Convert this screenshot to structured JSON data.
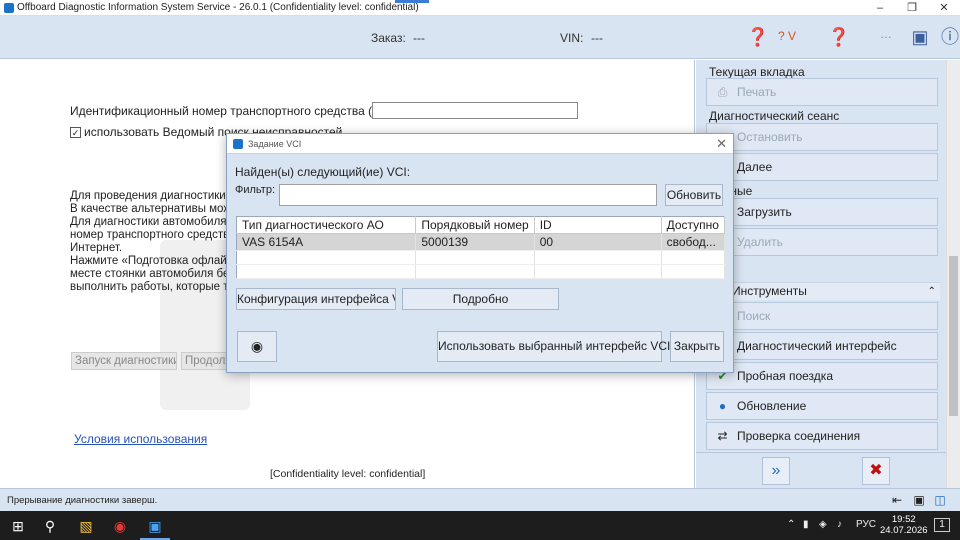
{
  "window": {
    "title": "Offboard Diagnostic Information System Service - 26.0.1 (Confidentiality level: confidential)",
    "controls": [
      "minimize-icon",
      "restore-icon",
      "close-icon"
    ]
  },
  "header": {
    "order_label": "Заказ:",
    "order_value": "---",
    "vin_label": "VIN:",
    "vin_value": "---",
    "help_version": "? V"
  },
  "main": {
    "vin_field_label": "Идентификационный номер транспортного средства (VIN)",
    "vin_field_value": "",
    "guided_search_label": "использовать Ведомый поиск неисправностей",
    "guided_search_checked": true,
    "paragraph_lines": [
      "Для проведения диагностики у",
      "В качестве альтернативы мож",
      "Для диагностики автомобиля в",
      "номер транспортного средства",
      "Интернет.",
      "Нажмите «Подготовка офлайн",
      "месте стоянки автомобиля без",
      "выполнить работы, которые тр"
    ],
    "start_diagnostics_button": "Запуск диагностики",
    "prepare_button": "Продолжить",
    "terms_link": "Условия использования",
    "confidentiality": "[Confidentiality level: confidential]"
  },
  "sidebar": {
    "current_tab_title": "Текущая вкладка",
    "print_button": "Печать",
    "session_title": "Диагностический сеанс",
    "stop_button": "Остановить",
    "next_button": "Далее",
    "data_title": "Данные",
    "load_button": "Загрузить",
    "delete_button": "Удалить",
    "tools_title": "Инструменты",
    "tools": [
      {
        "label": "Поиск",
        "icon": "search-icon",
        "disabled": true
      },
      {
        "label": "Диагностический интерфейс",
        "icon": "interface-icon",
        "disabled": false
      },
      {
        "label": "Пробная поездка",
        "icon": "test-drive-icon",
        "disabled": false
      },
      {
        "label": "Обновление",
        "icon": "globe-icon",
        "disabled": false
      },
      {
        "label": "Проверка соединения",
        "icon": "connection-icon",
        "disabled": false
      }
    ]
  },
  "dialog": {
    "title": "Задание VCI",
    "found_label": "Найден(ы) следующий(ие) VCI:",
    "filter_label": "Фильтр:",
    "filter_value": "",
    "refresh_button": "Обновить",
    "columns": [
      "Тип диагностического АО",
      "Порядковый номер",
      "ID",
      "Доступно"
    ],
    "rows": [
      [
        "VAS 6154A",
        "5000139",
        "00",
        "свобод..."
      ]
    ],
    "config_button": "Конфигурация интерфейса VCI",
    "details_button": "Подробно",
    "use_button": "Использовать выбранный интерфейс VCI",
    "close_button": "Закрыть"
  },
  "status": {
    "message": "Прерывание диагностики заверш."
  },
  "taskbar": {
    "language": "РУС",
    "time": "19:52",
    "date": "24.07.2026",
    "notifications": "1"
  },
  "colors": {
    "panel": "#d9e4f2",
    "link": "#2452b8",
    "taskbar": "#1d1d1d"
  }
}
